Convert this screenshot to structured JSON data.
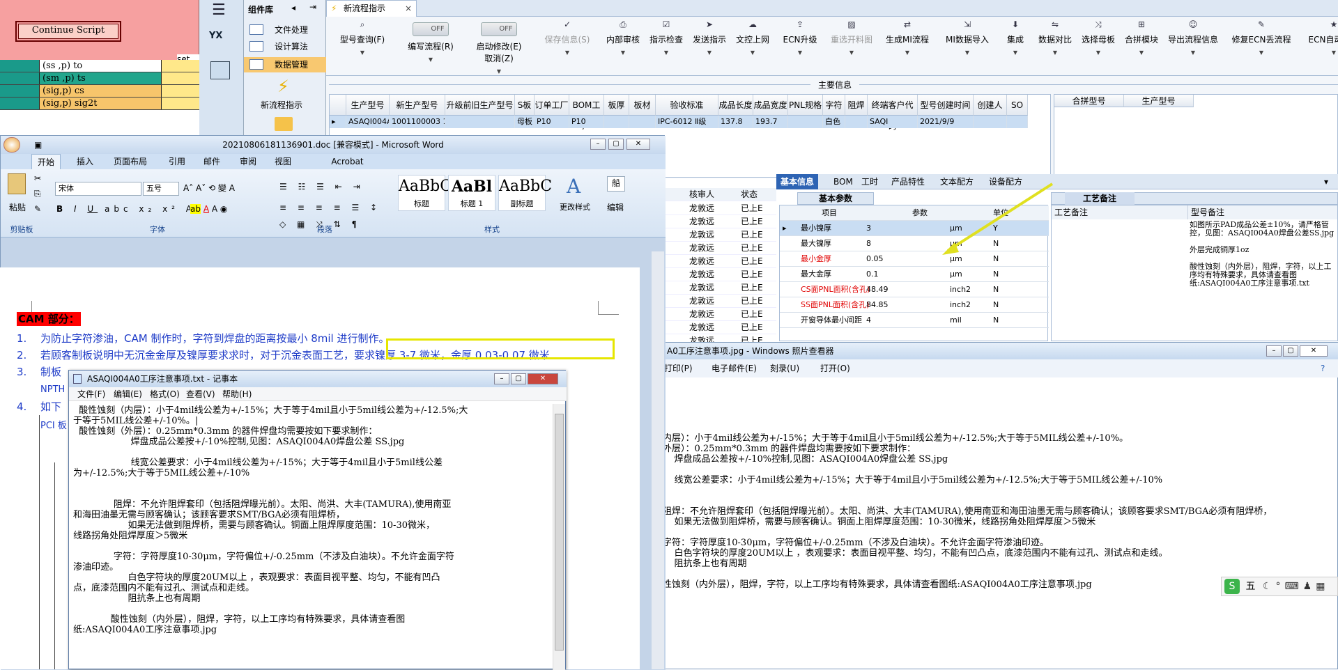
{
  "script_window": {
    "button": "Continue Script",
    "col_header": "set",
    "rows": [
      {
        "text": "(ss ,p) to",
        "color": "#ffffff"
      },
      {
        "text": "(sm ,p) ts",
        "color": "#22a58c"
      },
      {
        "text": "(sig,p) cs",
        "color": "#f7c56b"
      },
      {
        "text": "(sig,p) sig2t",
        "color": "#f7c56b"
      }
    ]
  },
  "toolstrip": {
    "yx_label": "YX"
  },
  "component_library": {
    "title": "组件库",
    "items": [
      "文件处理",
      "设计算法",
      "数据管理"
    ],
    "active_item": "数据管理",
    "big_item": "新流程指示"
  },
  "main_app": {
    "tab": "新流程指示",
    "toolbar": [
      {
        "label": "型号查询(F)",
        "icon": "search-icon"
      },
      {
        "label": "编写流程(R)",
        "toggle": "OFF"
      },
      {
        "label": "启动修改(E)",
        "label2": "取消(Z)",
        "toggle": "OFF"
      },
      {
        "label": "保存信息(S)",
        "icon": "check-icon",
        "disabled": true
      },
      {
        "label": "内部审核",
        "icon": "print-icon"
      },
      {
        "label": "指示检查",
        "icon": "checklist-icon"
      },
      {
        "label": "发送指示",
        "icon": "send-icon"
      },
      {
        "label": "文控上网",
        "icon": "cloud-upload-icon"
      },
      {
        "label": "ECN升级",
        "icon": "upgrade-icon"
      },
      {
        "label": "重选开料图",
        "icon": "image-icon",
        "disabled": true
      },
      {
        "label": "生成MI流程",
        "icon": "flow-icon"
      },
      {
        "label": "MI数据导入",
        "icon": "import-icon"
      },
      {
        "label": "集成",
        "icon": "integrate-icon"
      },
      {
        "label": "数据对比",
        "icon": "compare-icon"
      },
      {
        "label": "选择母板",
        "icon": "shuffle-icon"
      },
      {
        "label": "合拼模块",
        "icon": "merge-icon"
      },
      {
        "label": "导出流程信息",
        "icon": "smile-icon"
      },
      {
        "label": "修复ECN丢流程",
        "icon": "wrench-icon"
      },
      {
        "label": "ECN自动上网",
        "icon": "star-icon"
      }
    ],
    "main_info_title": "主要信息",
    "columns": [
      "生产型号",
      "新生产型号",
      "升级前旧生产型号",
      "S板",
      "订单工厂",
      "BOM工厂",
      "板厚",
      "板材",
      "验收标准",
      "成品长度",
      "成品宽度",
      "PNL规格",
      "字符",
      "阻焊",
      "终端客户代码",
      "型号创建时间",
      "创建人",
      "SO"
    ],
    "row": [
      "ASAQI004A0",
      "1001100003 1324",
      "",
      "母板",
      "P10",
      "P10",
      "",
      "",
      "IPC-6012 Ⅱ级",
      "137.8",
      "193.7",
      "",
      "白色",
      "",
      "SAQI",
      "2021/9/9",
      "",
      ""
    ],
    "merge_columns": [
      "合拼型号",
      "生产型号"
    ]
  },
  "word": {
    "title": "20210806181136901.doc [兼容模式] - Microsoft Word",
    "tabs": [
      "开始",
      "插入",
      "页面布局",
      "引用",
      "邮件",
      "审阅",
      "视图",
      "Acrobat"
    ],
    "font_name": "宋体",
    "font_size": "五号",
    "groups": [
      "剪贴板",
      "字体",
      "段落",
      "样式",
      "编辑"
    ],
    "paste": "粘贴",
    "styles": [
      {
        "preview": "AaBbC(",
        "name": "标题"
      },
      {
        "preview": "AaBl",
        "name": "标题 1"
      },
      {
        "preview": "AaBbC",
        "name": "副标题"
      }
    ],
    "change_style": "更改样式",
    "edit": "编辑",
    "heading": "CAM 部分：",
    "lines": [
      {
        "num": "1.",
        "text": "为防止字符渗油，CAM 制作时，字符到焊盘的距离按最小 8mil 进行制作。"
      },
      {
        "num": "2.",
        "text": "若顾客制板说明中无沉金金厚及镍厚要求求时，对于沉金表面工艺，要求镍厚 3-7 微米，金厚 0.03-0.07 微米"
      },
      {
        "num": "3.",
        "text": "制板"
      },
      {
        "num": "",
        "text": "NPTH"
      },
      {
        "num": "4.",
        "text": "如下"
      },
      {
        "num": "",
        "text": "PCI 板"
      }
    ],
    "highlight": "要求镍厚 3-7 微米，金厚 0.03-0.07 微米"
  },
  "notepad": {
    "title": "ASAQI004A0工序注意事项.txt - 记事本",
    "menu": [
      "文件(F)",
      "编辑(E)",
      "格式(O)",
      "查看(V)",
      "帮助(H)"
    ],
    "text": "  酸性蚀刻（内层）：小于4mil线公差为+/-15%；大于等于4mil且小于5mil线公差为+/-12.5%;大\n于等于5MIL线公差+/-10%。|\n  酸性蚀刻（外层）：0.25mm*0.3mm 的器件焊盘均需要按如下要求制作：\n                    焊盘成品公差按+/-10%控制,见图：ASAQI004A0焊盘公差 SS.jpg\n\n                    线宽公差要求：小于4mil线公差为+/-15%；大于等于4mil且小于5mil线公差\n为+/-12.5%;大于等于5MIL线公差+/-10%\n\n\n              阻焊：不允许阻焊套印（包括阻焊曝光前）。太阳、尚洪、大丰(TAMURA),使用南亚\n和海田油墨无需与顾客确认；该顾客要求SMT/BGA必须有阻焊桥，\n                   如果无法做到阻焊桥，需要与顾客确认。铜面上阻焊厚度范围：10-30微米，\n线路拐角处阻焊厚度＞5微米\n\n              字符：字符厚度10-30μm，字符偏位+/-0.25mm（不涉及白油块）。不允许金面字符\n渗油印迹。\n                   白色字符块的厚度20UM以上 ，表观要求：表面目视平整、均匀，不能有凹凸\n点，底漆范围内不能有过孔、测试点和走线。\n                   阻抗条上也有周期\n\n             酸性蚀刻（内外层），阻焊，字符，以上工序均有特殊要求，具体请查看图\n纸:ASAQI004A0工序注意事项.jpg"
  },
  "left_list": {
    "headers": [
      "核审人",
      "状态"
    ],
    "rows": [
      [
        "龙敦远",
        "已上E"
      ],
      [
        "龙敦远",
        "已上E"
      ],
      [
        "龙敦远",
        "已上E"
      ],
      [
        "龙敦远",
        "已上E"
      ],
      [
        "龙敦远",
        "已上E"
      ],
      [
        "龙敦远",
        "已上E"
      ],
      [
        "龙敦远",
        "已上E"
      ],
      [
        "龙敦远",
        "已上E"
      ],
      [
        "龙敦远",
        "已上E"
      ],
      [
        "龙敦远",
        "已上E"
      ],
      [
        "龙敦远",
        "已上E"
      ]
    ]
  },
  "basic_panel": {
    "tabs": [
      "基本信息",
      "BOM",
      "工时",
      "产品特性",
      "文本配方",
      "设备配方"
    ],
    "subtab": "基本参数",
    "notes_tab": "工艺备注",
    "param_headers": [
      "项目",
      "参数",
      "单位"
    ],
    "params": [
      {
        "item": "最小镍厚",
        "value": "3",
        "unit": "μm",
        "flag": "Y",
        "red": false
      },
      {
        "item": "最大镍厚",
        "value": "8",
        "unit": "μm",
        "flag": "N",
        "red": false
      },
      {
        "item": "最小金厚",
        "value": "0.05",
        "unit": "μm",
        "flag": "N",
        "red": true
      },
      {
        "item": "最大金厚",
        "value": "0.1",
        "unit": "μm",
        "flag": "N",
        "red": false
      },
      {
        "item": "CS面PNL面积(含孔)",
        "value": "48.49",
        "unit": "inch2",
        "flag": "N",
        "red": true
      },
      {
        "item": "SS面PNL面积(含孔)",
        "value": "84.85",
        "unit": "inch2",
        "flag": "N",
        "red": true
      },
      {
        "item": "开窗导体最小间距",
        "value": "4",
        "unit": "mil",
        "flag": "N",
        "red": false
      }
    ],
    "notes_headers": [
      "工艺备注",
      "型号备注"
    ],
    "model_note": "如图所示PAD成品公差±10%，请严格管控，见图：ASAQI004A0焊盘公差SS.jpg\n\n外层完成铜厚1oz\n\n酸性蚀刻（内外层），阻焊，字符，以上工序均有特殊要求，具体请查看图纸:ASAQI004A0工序注意事项.txt"
  },
  "photo_viewer": {
    "title": "A0工序注意事项.jpg - Windows 照片查看器",
    "menu": [
      "打印(P)",
      "电子邮件(E)",
      "刻录(U)",
      "打开(O)"
    ],
    "text": "内层）：小于4mil线公差为+/-15%；大于等于4mil且小于5mil线公差为+/-12.5%;大于等于5MIL线公差+/-10%。\n外层）：0.25mm*0.3mm 的器件焊盘均需要按如下要求制作：\n    焊盘成品公差按+/-10%控制,见图：ASAQI004A0焊盘公差 SS.jpg\n\n    线宽公差要求：小于4mil线公差为+/-15%；大于等于4mil且小于5mil线公差为+/-12.5%;大于等于5MIL线公差+/-10%\n\n\n阻焊：不允许阻焊套印（包括阻焊曝光前）。太阳、尚洪、大丰(TAMURA),使用南亚和海田油墨无需与顾客确认；该顾客要求SMT/BGA必须有阻焊桥，\n    如果无法做到阻焊桥，需要与顾客确认。铜面上阻焊厚度范围：10-30微米，线路拐角处阻焊厚度＞5微米\n\n字符：字符厚度10-30μm，字符偏位+/-0.25mm（不涉及白油块）。不允许金面字符渗油印迹。\n    白色字符块的厚度20UM以上 ，表观要求：表面目视平整、均匀，不能有凹凸点，底漆范围内不能有过孔、测试点和走线。\n    阻抗条上也有周期\n\n性蚀刻（内外层），阻焊，字符，以上工序均有特殊要求，具体请查看图纸:ASAQI004A0工序注意事项.jpg"
  },
  "ime": {
    "label": "五"
  },
  "colors": {
    "accent": "#1f3cc8",
    "highlight_box": "#e6e600",
    "arrow": "#e0e020",
    "red": "#e00000"
  }
}
